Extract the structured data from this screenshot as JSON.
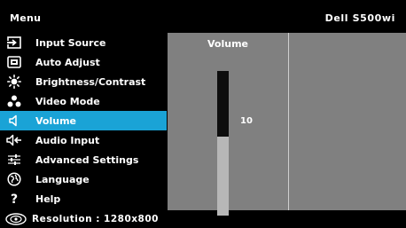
{
  "header": {
    "menu_title": "Menu",
    "model": "Dell S500wi"
  },
  "menu": {
    "items": [
      {
        "label": "Input Source",
        "icon": "input-source-icon"
      },
      {
        "label": "Auto Adjust",
        "icon": "auto-adjust-icon"
      },
      {
        "label": "Brightness/Contrast",
        "icon": "brightness-icon"
      },
      {
        "label": "Video Mode",
        "icon": "video-mode-icon"
      },
      {
        "label": "Volume",
        "icon": "volume-icon"
      },
      {
        "label": "Audio Input",
        "icon": "audio-input-icon"
      },
      {
        "label": "Advanced Settings",
        "icon": "advanced-settings-icon"
      },
      {
        "label": "Language",
        "icon": "language-icon"
      },
      {
        "label": "Help",
        "icon": "help-icon"
      }
    ],
    "selected_label": "Volume"
  },
  "panel": {
    "title": "Volume",
    "value": "10"
  },
  "footer": {
    "resolution_text": "Resolution : 1280x800"
  },
  "colors": {
    "selected": "#1aa3d6",
    "panel_bg": "#808080",
    "background": "#000000"
  }
}
